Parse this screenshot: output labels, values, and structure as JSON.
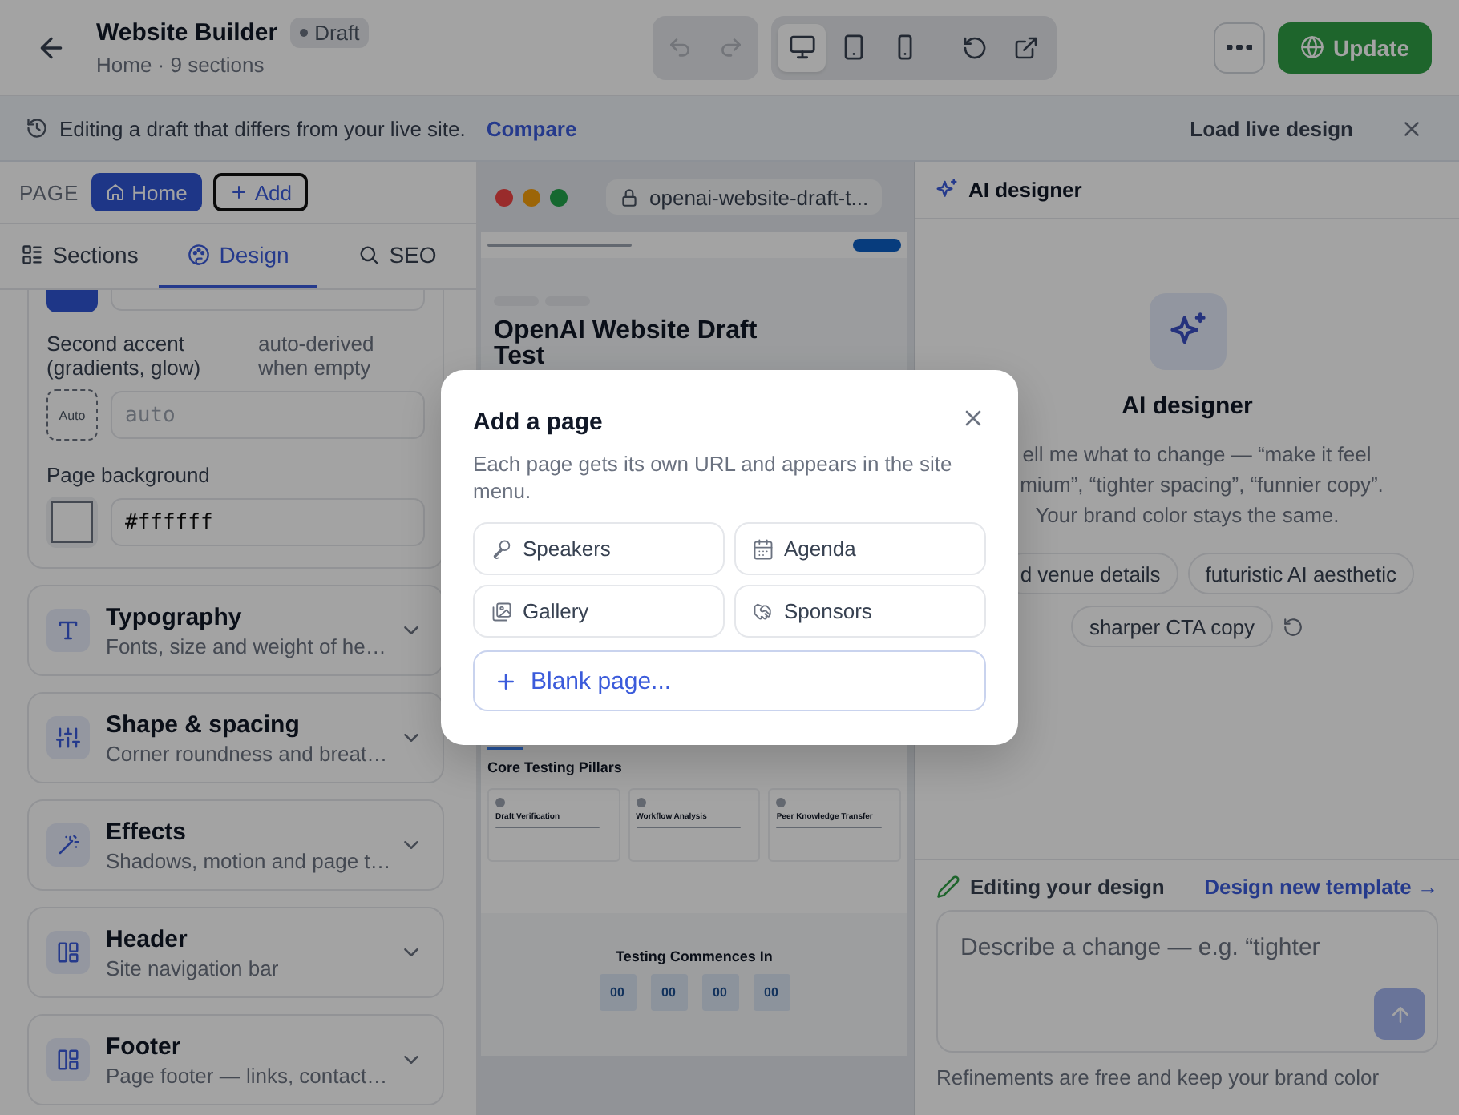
{
  "header": {
    "title": "Website Builder",
    "status": "Draft",
    "subtitle": "Home · 9 sections",
    "update_label": "Update"
  },
  "toolbar": {
    "undo_disabled": true,
    "redo_disabled": true,
    "devices": [
      {
        "kind": "desktop",
        "selected": true
      },
      {
        "kind": "tablet",
        "selected": false
      },
      {
        "kind": "phone",
        "selected": false
      }
    ]
  },
  "banner": {
    "message": "Editing a draft that differs from your live site.",
    "link": "Compare",
    "action": "Load live design"
  },
  "pages": {
    "label": "PAGE",
    "items": [
      {
        "label": "Home",
        "selected": true
      }
    ],
    "add_label": "Add"
  },
  "panel_tabs": [
    {
      "kind": "sections",
      "label": "Sections",
      "selected": false
    },
    {
      "kind": "design",
      "label": "Design",
      "selected": true
    },
    {
      "kind": "seo",
      "label": "SEO",
      "selected": false
    }
  ],
  "design": {
    "second_accent": {
      "label": "Second accent (gradients, glow)",
      "hint": "auto-derived when empty",
      "swatch_label": "Auto",
      "placeholder": "auto"
    },
    "page_background": {
      "label": "Page background",
      "value": "#ffffff"
    }
  },
  "sections": [
    {
      "kind": "typography",
      "title": "Typography",
      "subtitle": "Fonts, size and weight of he…",
      "expanded": false
    },
    {
      "kind": "shape",
      "title": "Shape & spacing",
      "subtitle": "Corner roundness and breat…",
      "expanded": false
    },
    {
      "kind": "effects",
      "title": "Effects",
      "subtitle": "Shadows, motion and page t…",
      "expanded": false
    },
    {
      "kind": "header",
      "title": "Header",
      "subtitle": "Site navigation bar",
      "expanded": false
    },
    {
      "kind": "footer",
      "title": "Footer",
      "subtitle": "Page footer — links, contact…",
      "expanded": false
    }
  ],
  "preview": {
    "url": "openai-website-draft-t...",
    "heading": "OpenAI Website Draft Test",
    "section_title": "Core Testing Pillars",
    "cards": [
      {
        "title": "Draft Verification"
      },
      {
        "title": "Workflow Analysis"
      },
      {
        "title": "Peer Knowledge Transfer"
      }
    ],
    "countdown_title": "Testing Commences In",
    "countdown": [
      "00",
      "00",
      "00",
      "00"
    ]
  },
  "ai": {
    "title": "AI designer",
    "hero_title": "AI designer",
    "intro_lines": [
      "ell me what to change — “make it feel",
      "mium”, “tighter spacing”, “funnier copy”.",
      "Your brand color stays the same."
    ],
    "suggestions": [
      [
        "d venue details",
        "futuristic AI aesthetic"
      ],
      [
        "sharper CTA copy"
      ]
    ],
    "editing_label": "Editing your design",
    "template_link": "Design new template →",
    "prompt_placeholder": "Describe a change — e.g. “tighter",
    "note": "Refinements are free and keep your brand color"
  },
  "modal": {
    "title": "Add a page",
    "description": "Each page gets its own URL and appears in the site menu.",
    "templates": [
      {
        "kind": "speakers",
        "label": "Speakers"
      },
      {
        "kind": "agenda",
        "label": "Agenda"
      },
      {
        "kind": "gallery",
        "label": "Gallery"
      },
      {
        "kind": "sponsors",
        "label": "Sponsors"
      }
    ],
    "blank_label": "Blank page..."
  }
}
